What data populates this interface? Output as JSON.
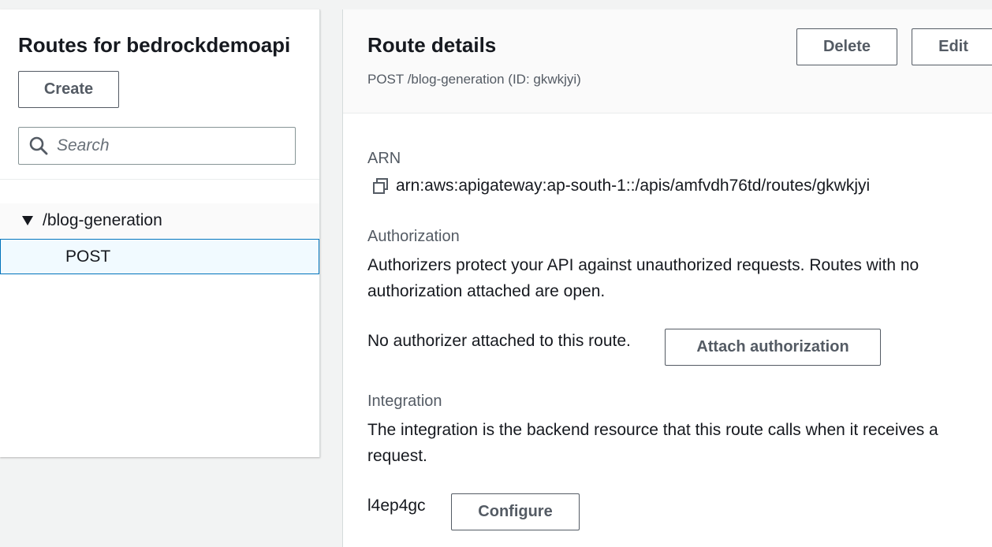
{
  "left": {
    "title": "Routes for bedrockdemoapi",
    "create_label": "Create",
    "search_placeholder": "Search",
    "tree": {
      "path": "/blog-generation",
      "method": "POST"
    }
  },
  "details": {
    "title": "Route details",
    "subtitle": "POST /blog-generation (ID: gkwkjyi)",
    "delete_label": "Delete",
    "edit_label": "Edit",
    "arn_label": "ARN",
    "arn_value": "arn:aws:apigateway:ap-south-1::/apis/amfvdh76td/routes/gkwkjyi",
    "authorization": {
      "label": "Authorization",
      "description": "Authorizers protect your API against unauthorized requests. Routes with no authorization attached are open.",
      "status": "No authorizer attached to this route.",
      "button_label": "Attach authorization"
    },
    "integration": {
      "label": "Integration",
      "description": "The integration is the backend resource that this route calls when it receives a request.",
      "id": "l4ep4gc",
      "button_label": "Configure"
    }
  },
  "colors": {
    "background": "#f2f3f3",
    "selected_border": "#0073bb",
    "button_text": "#545b64"
  }
}
